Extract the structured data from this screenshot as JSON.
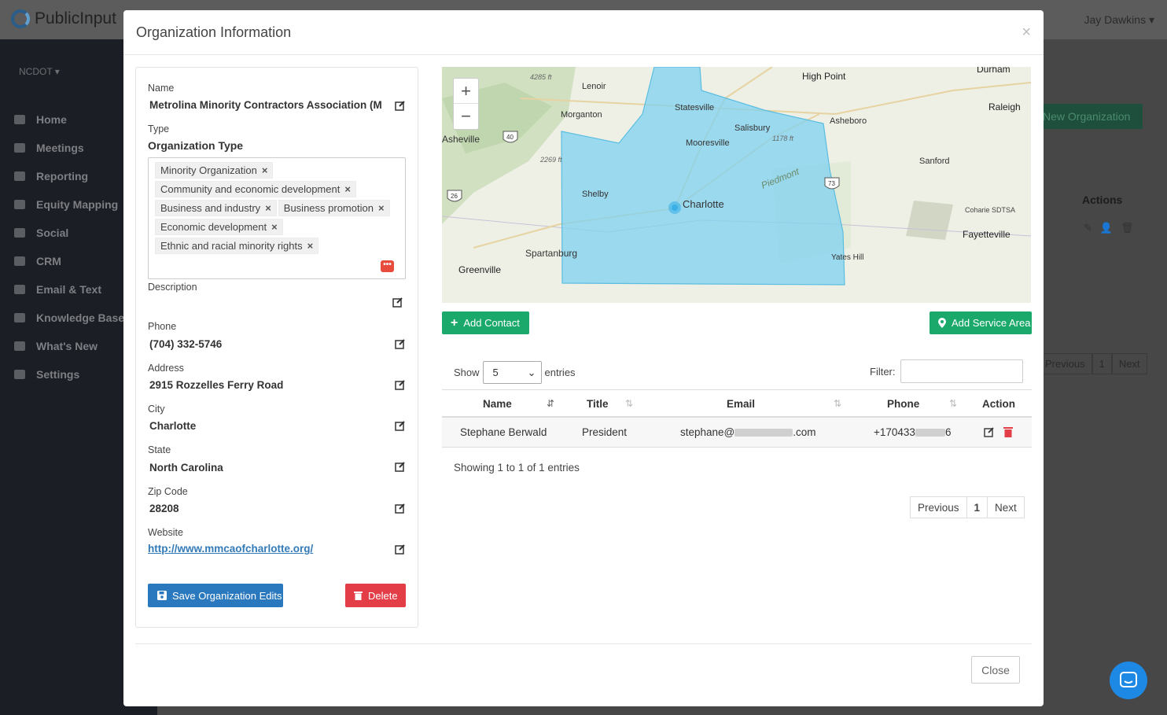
{
  "app": {
    "logo_text": "PublicInput",
    "user": "Jay Dawkins",
    "org_switcher": "NCDOT"
  },
  "sidebar": {
    "items": [
      {
        "label": "Home",
        "icon": "home-icon"
      },
      {
        "label": "Meetings",
        "icon": "calendar-icon"
      },
      {
        "label": "Reporting",
        "icon": "chart-icon"
      },
      {
        "label": "Equity Mapping",
        "icon": "map-icon"
      },
      {
        "label": "Social",
        "icon": "globe-icon"
      },
      {
        "label": "CRM",
        "icon": "id-card-icon"
      },
      {
        "label": "Email & Text",
        "icon": "mail-icon"
      },
      {
        "label": "Knowledge Base",
        "icon": "book-icon"
      },
      {
        "label": "What's New",
        "icon": "sparkle-icon"
      },
      {
        "label": "Settings",
        "icon": "gear-icon"
      }
    ]
  },
  "background": {
    "new_org_button": "New Organization",
    "actions_header": "Actions",
    "pager": [
      "Previous",
      "1",
      "Next"
    ]
  },
  "modal": {
    "title": "Organization Information",
    "close_x": "×",
    "fields": {
      "name_label": "Name",
      "name_value": "Metrolina Minority Contractors Association (M",
      "type_label": "Type",
      "type_group_label": "Organization Type",
      "type_tags": [
        "Minority Organization",
        "Community and economic development",
        "Business and industry",
        "Business promotion",
        "Economic development",
        "Ethnic and racial minority rights"
      ],
      "tag_remove": "×",
      "description_label": "Description",
      "phone_label": "Phone",
      "phone_value": "(704) 332-5746",
      "address_label": "Address",
      "address_value": "2915 Rozzelles Ferry Road",
      "city_label": "City",
      "city_value": "Charlotte",
      "state_label": "State",
      "state_value": "North Carolina",
      "zip_label": "Zip Code",
      "zip_value": "28208",
      "website_label": "Website",
      "website_value": "http://www.mmcaofcharlotte.org/"
    },
    "buttons": {
      "save": "Save Organization Edits",
      "delete": "Delete",
      "add_contact": "Add Contact",
      "add_service_area": "Add Service Area",
      "close": "Close"
    },
    "map": {
      "zoom_in": "+",
      "zoom_out": "−",
      "labels": [
        "Durham",
        "High Point",
        "Lenoir",
        "Statesville",
        "Raleigh",
        "Morganton",
        "Asheboro",
        "Salisbury",
        "Mooresville",
        "Asheville",
        "Sanford",
        "Piedmont",
        "Shelby",
        "Charlotte",
        "Coharie SDTSA",
        "Fayetteville",
        "Spartanburg",
        "Yates Hill",
        "Greenville"
      ],
      "elevation_labels": [
        "4285 ft",
        "2269 ft",
        "1178 ft"
      ],
      "highway_shields": [
        "40",
        "26",
        "73"
      ]
    },
    "table": {
      "show_label": "Show",
      "entries_label": "entries",
      "page_size": "5",
      "filter_label": "Filter:",
      "filter_value": "",
      "columns": [
        "Name",
        "Title",
        "Email",
        "Phone",
        "Action"
      ],
      "rows": [
        {
          "name": "Stephane Berwald",
          "title": "President",
          "email_start": "stephane@",
          "email_end": ".com",
          "phone_start": "+170433",
          "phone_end": "6"
        }
      ],
      "info": "Showing 1 to 1 of 1 entries",
      "pager": {
        "previous": "Previous",
        "current": "1",
        "next": "Next"
      }
    }
  },
  "colors": {
    "primary": "#2a79bf",
    "success": "#1aa96b",
    "danger": "#e33d47",
    "service_area": "#7fd1f0"
  }
}
